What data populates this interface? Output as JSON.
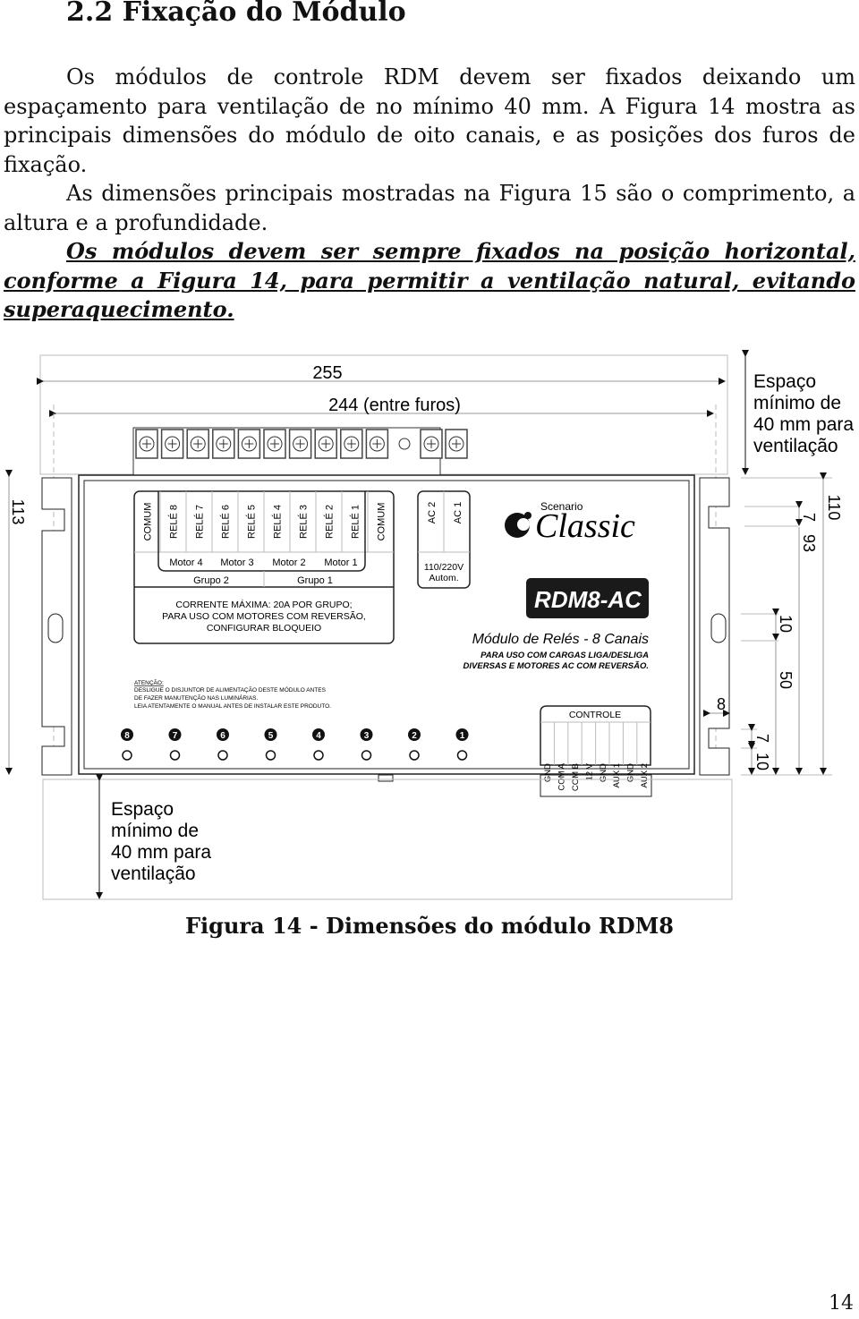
{
  "section": {
    "title": "2.2 Fixação do Módulo"
  },
  "paragraphs": [
    "Os módulos de controle RDM devem ser fixados deixando um espaçamento para ventilação de no mínimo 40 mm. A Figura 14 mostra as principais dimensões do módulo de oito canais, e as posições dos furos de fixação.",
    "As dimensões principais mostradas na Figura 15 são o comprimento, a altura e a profundidade.",
    "Os módulos devem ser sempre fixados na posição horizontal, conforme a Figura 14, para permitir a ventilação natural, evitando superaquecimento."
  ],
  "figure": {
    "dimensions": {
      "length": "255",
      "holes": "244 (entre furos)",
      "height_left": "113",
      "height_right": "110",
      "d93": "93",
      "d7_top": "7",
      "d10_mid": "10",
      "d50": "50",
      "d8": "8",
      "d7_bottom": "7",
      "d10_bottom": "10"
    },
    "ventilation_top": [
      "Espaço",
      "mínimo de",
      "40 mm para",
      "ventilação"
    ],
    "ventilation_bottom": [
      "Espaço",
      "mínimo de",
      "40 mm para",
      "ventilação"
    ],
    "terminals": [
      "COMUM",
      "RELÉ 8",
      "RELÉ 7",
      "RELÉ 6",
      "RELÉ 5",
      "RELÉ 4",
      "RELÉ 3",
      "RELÉ 2",
      "RELÉ 1",
      "COMUM"
    ],
    "motors": [
      "Motor 4",
      "Motor 3",
      "Motor 2",
      "Motor 1"
    ],
    "groups": [
      "Grupo 2",
      "Grupo 1"
    ],
    "current_note": [
      "CORRENTE MÁXIMA: 20A POR GRUPO;",
      "PARA USO COM MOTORES COM REVERSÃO,",
      "CONFIGURAR BLOQUEIO"
    ],
    "ac_terminals": [
      "AC 2",
      "AC 1"
    ],
    "ac_label": [
      "110/220V",
      "Autom."
    ],
    "brand_small": "Scenario",
    "brand_large": "Classic",
    "model": "RDM8-AC",
    "subtitle": "Módulo de Relés - 8 Canais",
    "usage_note": [
      "PARA USO COM CARGAS LIGA/DESLIGA",
      "DIVERSAS E MOTORES AC COM REVERSÃO."
    ],
    "warning": [
      "ATENÇÃO:",
      "DESLIGUE O DISJUNTOR DE ALIMENTAÇÃO DESTE MÓDULO ANTES",
      "DE FAZER MANUTENÇÃO NAS LUMINÁRIAS.",
      "LEIA ATENTAMENTE O MANUAL ANTES DE INSTALAR ESTE PRODUTO."
    ],
    "channels": [
      "8",
      "7",
      "6",
      "5",
      "4",
      "3",
      "2",
      "1"
    ],
    "control_title": "CONTROLE",
    "control_pins": [
      "GND",
      "COM A",
      "COM B",
      "12 V",
      "GND",
      "AUX 1",
      "GND",
      "AUX 2"
    ]
  },
  "caption": "Figura 14 - Dimensões do módulo RDM8",
  "page_number": "14"
}
